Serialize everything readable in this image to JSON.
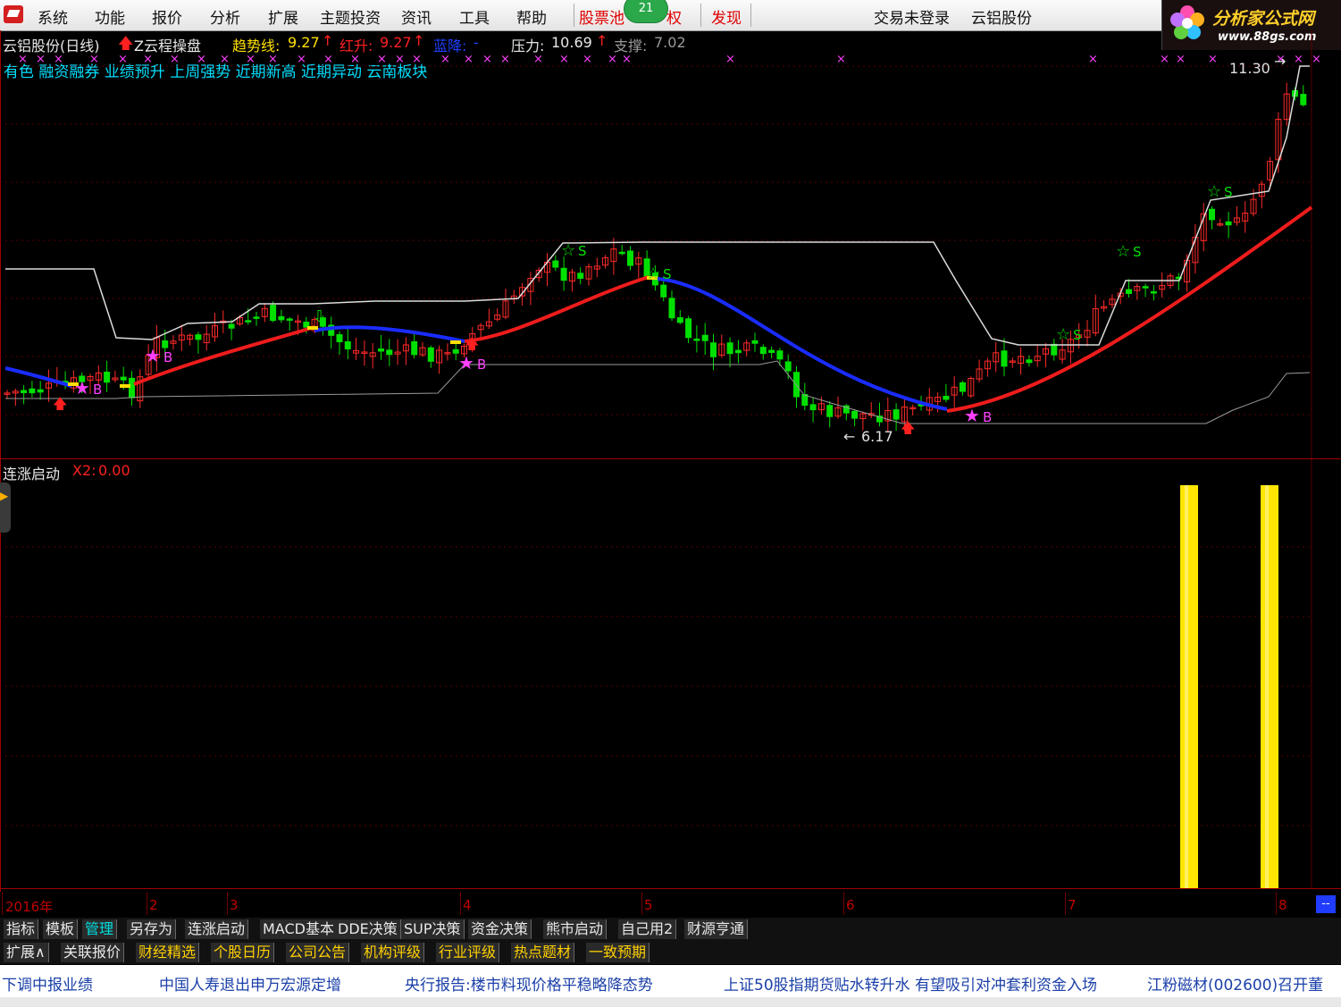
{
  "menu": {
    "items": [
      "系统",
      "功能",
      "报价",
      "分析",
      "扩展",
      "主题投资",
      "资讯",
      "工具",
      "帮助"
    ],
    "stock_pool": "股票池",
    "badge": "21",
    "rights": "权",
    "discover": "发现",
    "trade_status": "交易未登录",
    "stock_name": "云铝股份"
  },
  "site": {
    "name": "分析家公式网",
    "url": "www.88gs.com"
  },
  "chart_header": {
    "stock": "云铝股份(日线)",
    "indicator": "Z云程操盘",
    "trend_label": "趋势线:",
    "trend_value": "9.27",
    "red_label": "红升:",
    "red_value": "9.27",
    "blue_label": "蓝降:",
    "blue_value": "-",
    "pressure_label": "压力:",
    "pressure_value": "10.69",
    "support_label": "支撑:",
    "support_value": "7.02"
  },
  "concepts": "有色 融资融券 业绩预升 上周强势 近期新高 近期异动 云南板块",
  "price_labels": {
    "high": "11.30",
    "low": "6.17"
  },
  "signals": {
    "buy": "B",
    "sell": "S"
  },
  "sub_panel": {
    "name": "连涨启动",
    "x2_label": "X2:",
    "x2_value": "0.00"
  },
  "time_axis": [
    "2016年",
    "2",
    "3",
    "4",
    "5",
    "6",
    "7",
    "8"
  ],
  "time_axis_end": "--",
  "tabs_row1": [
    "指标",
    "模板",
    "管理",
    "另存为",
    "连涨启动",
    "MACD基本",
    "DDE决策",
    "SUP决策",
    "资金决策",
    "熊市启动",
    "自己用2",
    "财源亨通"
  ],
  "tabs_row2": [
    "扩展∧",
    "关联报价",
    "财经精选",
    "个股日历",
    "公司公告",
    "机构评级",
    "行业评级",
    "热点题材",
    "一致预期"
  ],
  "news": [
    "下调中报业绩",
    "中国人寿退出申万宏源定增",
    "央行报告:楼市料现价格平稳略降态势",
    "上证50股指期货贴水转升水 有望吸引对冲套利资金入场",
    "江粉磁材(002600)召开董"
  ],
  "colors": {
    "up": "#ff2a2a",
    "down": "#00e000",
    "trend_up": "#ee1c1c",
    "trend_down": "#1a2cff",
    "bar": "#ffe600"
  },
  "chart_data": {
    "type": "candlestick",
    "x_axis": [
      "2016年",
      "2",
      "3",
      "4",
      "5",
      "6",
      "7",
      "8"
    ],
    "y_labels_shown": {
      "high": 11.3,
      "low": 6.17
    },
    "current": {
      "trend": 9.27,
      "pressure": 10.69,
      "support": 7.02
    },
    "sub_series": {
      "name": "连涨启动",
      "x2": 0.0
    }
  }
}
